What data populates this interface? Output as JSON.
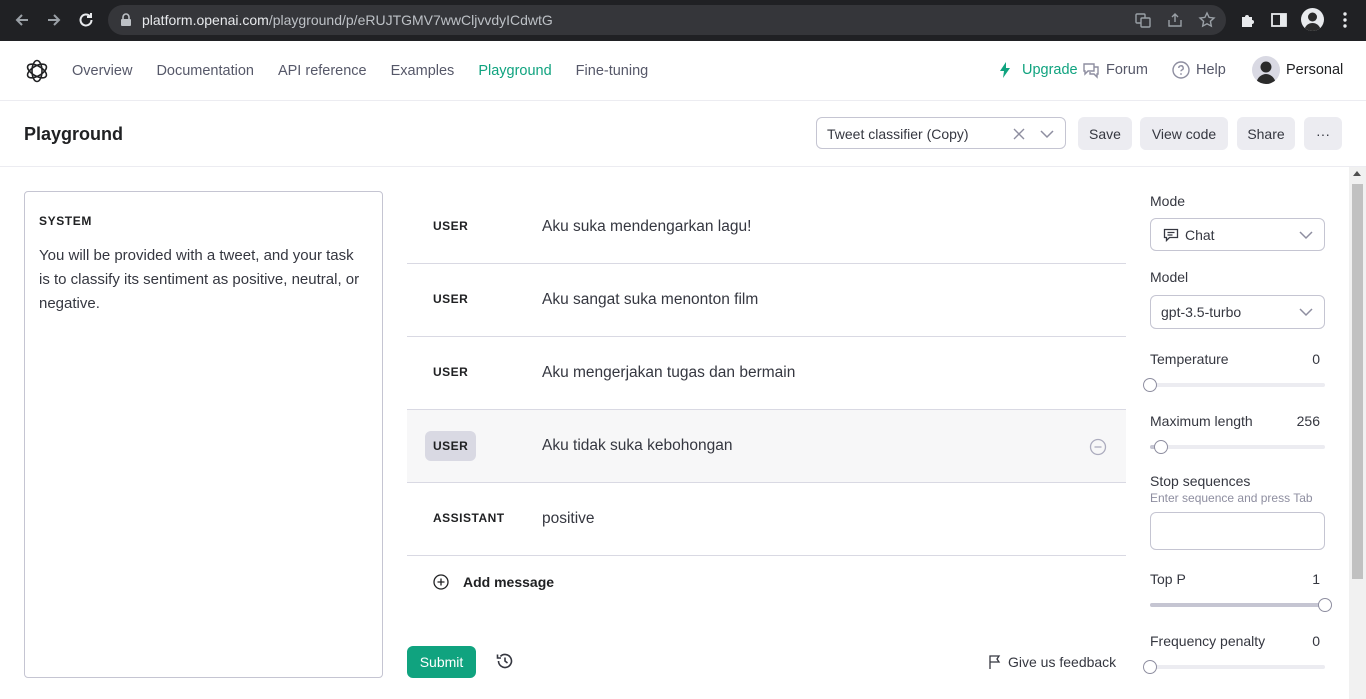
{
  "browser": {
    "url_host": "platform.openai.com",
    "url_path": "/playground/p/eRUJTGMV7wwCljvvdyICdwtG"
  },
  "nav": {
    "links": [
      "Overview",
      "Documentation",
      "API reference",
      "Examples",
      "Playground",
      "Fine-tuning"
    ],
    "active": "Playground",
    "upgrade": "Upgrade",
    "forum": "Forum",
    "help": "Help",
    "account": "Personal"
  },
  "header": {
    "title": "Playground",
    "preset": "Tweet classifier (Copy)",
    "save": "Save",
    "view_code": "View code",
    "share": "Share",
    "more": "···"
  },
  "system": {
    "label": "SYSTEM",
    "text": "You will be provided with a tweet, and your task is to classify its sentiment as positive, neutral, or negative."
  },
  "messages": [
    {
      "role": "USER",
      "content": "Aku suka mendengarkan lagu!"
    },
    {
      "role": "USER",
      "content": "Aku sangat suka menonton film"
    },
    {
      "role": "USER",
      "content": "Aku mengerjakan tugas dan bermain"
    },
    {
      "role": "USER",
      "content": "Aku tidak suka kebohongan"
    },
    {
      "role": "ASSISTANT",
      "content": "positive"
    }
  ],
  "add_message": "Add message",
  "actions": {
    "submit": "Submit",
    "feedback": "Give us feedback"
  },
  "settings": {
    "mode_label": "Mode",
    "mode_value": "Chat",
    "model_label": "Model",
    "model_value": "gpt-3.5-turbo",
    "temperature_label": "Temperature",
    "temperature_value": "0",
    "max_length_label": "Maximum length",
    "max_length_value": "256",
    "stop_label": "Stop sequences",
    "stop_hint": "Enter sequence and press Tab",
    "top_p_label": "Top P",
    "top_p_value": "1",
    "freq_label": "Frequency penalty",
    "freq_value": "0"
  },
  "colors": {
    "accent": "#10a37f"
  }
}
